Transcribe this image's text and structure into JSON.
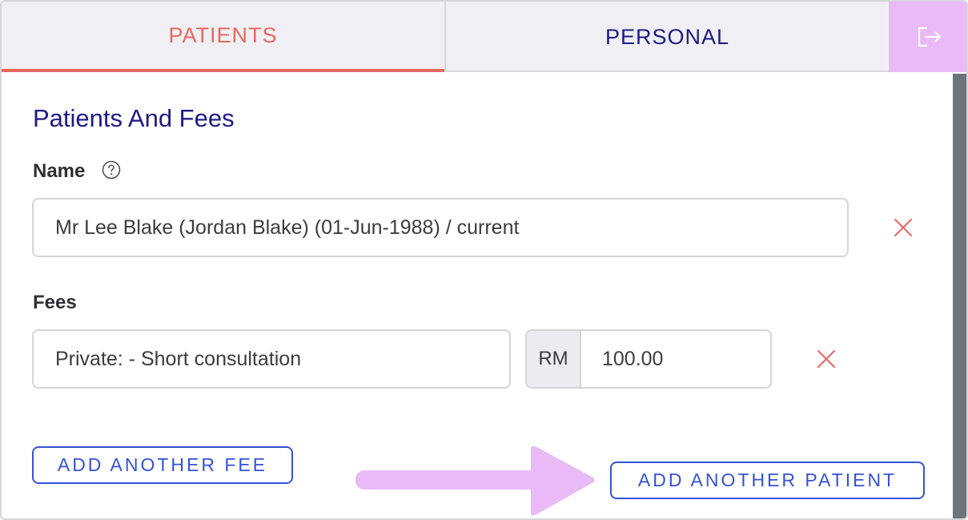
{
  "tabs": {
    "patients": "PATIENTS",
    "personal": "PERSONAL"
  },
  "header": {
    "logout_icon": "logout-icon"
  },
  "form": {
    "title": "Patients And Fees",
    "name_label": "Name",
    "name_value": "Mr Lee Blake (Jordan Blake) (01-Jun-1988) / current",
    "fees_label": "Fees",
    "fee_value": "Private:  - Short consultation",
    "currency": "RM",
    "amount": "100.00"
  },
  "actions": {
    "add_fee": "ADD ANOTHER FEE",
    "add_patient": "ADD ANOTHER PATIENT"
  },
  "colors": {
    "active_tab": "#e8675f",
    "navy": "#1e1a86",
    "button_blue": "#3552d8",
    "highlight_pink": "#e9baf6",
    "remove_red": "#e8675f"
  }
}
